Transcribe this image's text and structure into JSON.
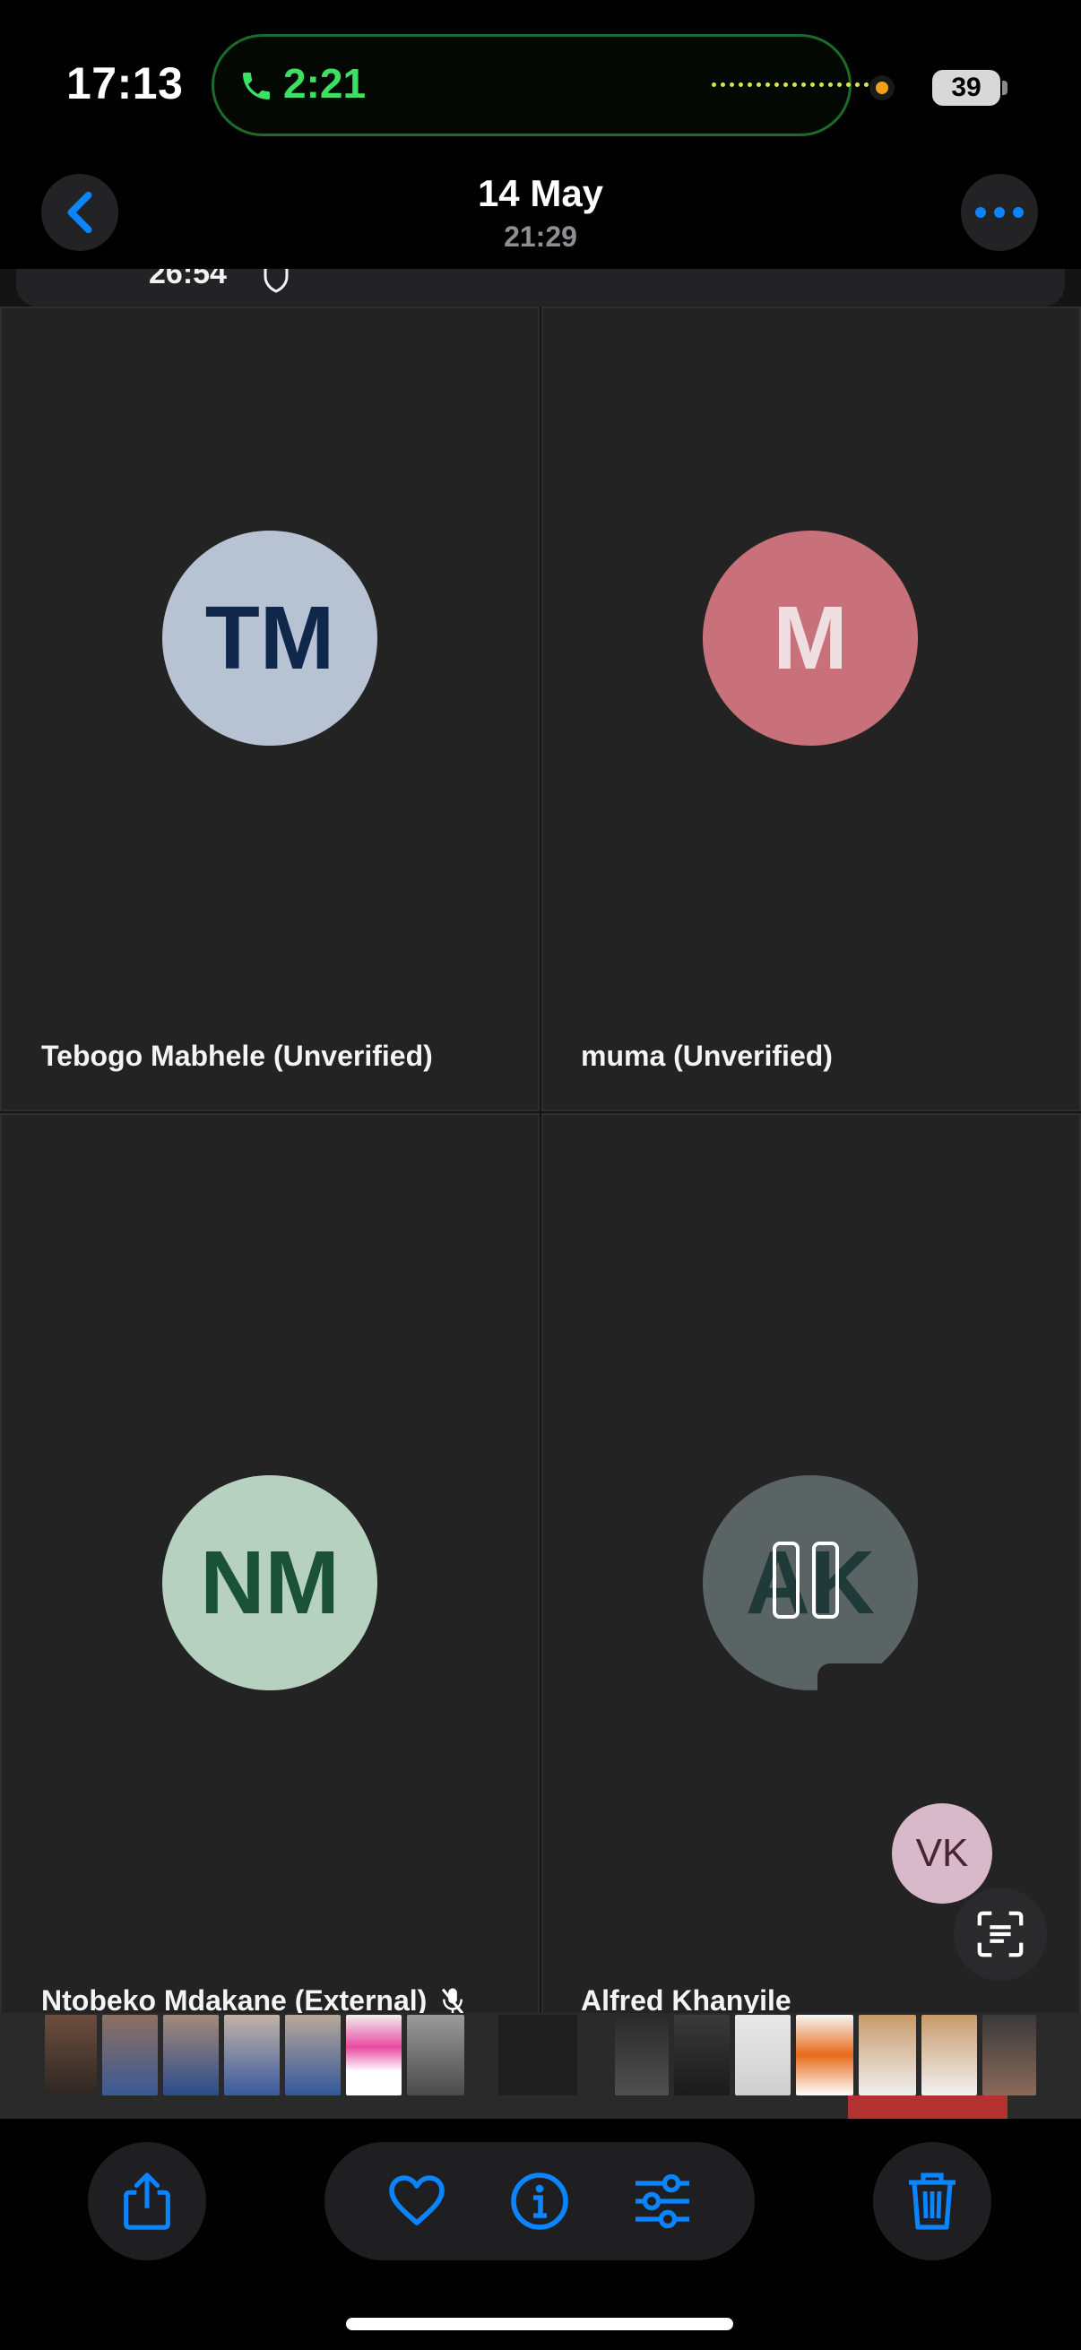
{
  "status_bar": {
    "time": "17:13",
    "call_duration": "2:21",
    "battery_level": "39"
  },
  "header": {
    "date": "14 May",
    "time": "21:29"
  },
  "meeting": {
    "timer": "26:54",
    "participants": [
      {
        "initials": "TM",
        "name": "Tebogo Mabhele (Unverified)",
        "avatar_bg": "#b7c2d3",
        "avatar_fg": "#0e274b"
      },
      {
        "initials": "M",
        "name": "muma (Unverified)",
        "avatar_bg": "#c8717a",
        "avatar_fg": "#f0dfe0"
      },
      {
        "initials": "NM",
        "name": "Ntobeko Mdakane (External)",
        "avatar_bg": "#b7d1c1",
        "avatar_fg": "#1b5136"
      },
      {
        "initials": "AK",
        "name": "Alfred Khanyile",
        "avatar_bg": "#5a6464",
        "avatar_fg": "#1f3a38"
      }
    ],
    "floating_avatar": {
      "initials": "VK"
    }
  },
  "toolbar": {
    "share": "share-icon",
    "favorite": "heart-icon",
    "info": "info-icon",
    "adjust": "sliders-icon",
    "delete": "trash-icon"
  },
  "colors": {
    "accent": "#0a84ff",
    "call_green": "#3ee063"
  }
}
